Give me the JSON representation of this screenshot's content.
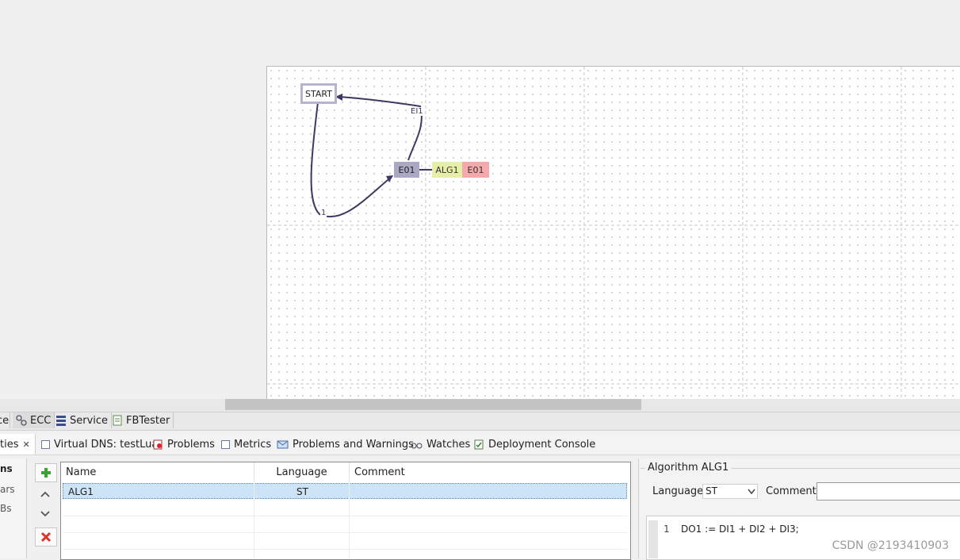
{
  "ecc": {
    "start_state": "START",
    "state_e01": "E01",
    "action_algorithm": "ALG1",
    "action_output_event": "E01",
    "transition_1_label": "1",
    "transition_2_label": "EI1"
  },
  "editor_tabs": [
    "ce",
    "ECC",
    "Service",
    "FBTester"
  ],
  "view_tabs": {
    "properties": "ties",
    "virtual_dns": "Virtual DNS: testLua",
    "problems": "Problems",
    "metrics": "Metrics",
    "problems_warnings": "Problems and Warnings",
    "watches": "Watches",
    "deployment_console": "Deployment Console"
  },
  "side_items": [
    "ns",
    "ars",
    "Bs"
  ],
  "table": {
    "columns": [
      "Name",
      "Language",
      "Comment"
    ],
    "rows": [
      {
        "name": "ALG1",
        "language": "ST",
        "comment": ""
      }
    ]
  },
  "algorithm": {
    "title": "Algorithm ALG1",
    "language_label": "Language",
    "language_value": "ST",
    "comment_label": "Comment",
    "comment_value": "",
    "code_line_number": "1",
    "code_line": "DO1 := DI1 + DI2 + DI3;"
  },
  "watermark": "CSDN @2193410903",
  "colors": {
    "state_fill": "#aba8c6",
    "algorithm_fill": "#e6efa8",
    "event_fill": "#f5a9ad",
    "transition_stroke": "#3c3a63",
    "delete_icon": "#e0312b",
    "add_icon": "#3aa335"
  }
}
